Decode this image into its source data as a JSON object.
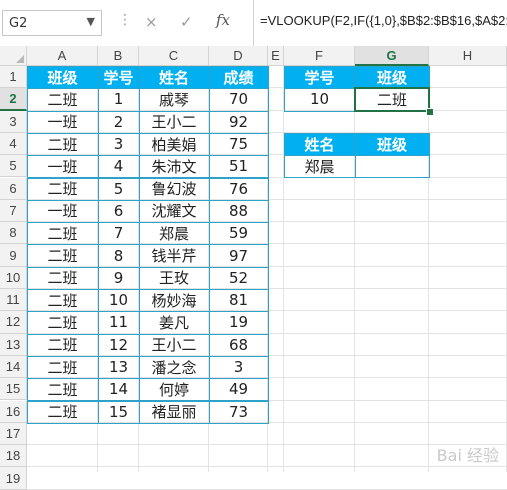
{
  "name_box": {
    "value": "G2"
  },
  "formula_bar": {
    "cancel_icon": "×",
    "enter_icon": "✓",
    "fx_label": "fx",
    "formula": "=VLOOKUP(F2,IF({1,0},$B$2:$B$16,$A$2:$"
  },
  "columns": [
    "A",
    "B",
    "C",
    "D",
    "E",
    "F",
    "G",
    "H"
  ],
  "rows": [
    "1",
    "2",
    "3",
    "4",
    "5",
    "6",
    "7",
    "8",
    "9",
    "10",
    "11",
    "12",
    "13",
    "14",
    "15",
    "16",
    "17",
    "18",
    "19"
  ],
  "table": {
    "headers": [
      "班级",
      "学号",
      "姓名",
      "成绩"
    ],
    "rows": [
      [
        "二班",
        "1",
        "戚琴",
        "70"
      ],
      [
        "一班",
        "2",
        "王小二",
        "92"
      ],
      [
        "二班",
        "3",
        "柏美娟",
        "75"
      ],
      [
        "一班",
        "4",
        "朱沛文",
        "51"
      ],
      [
        "二班",
        "5",
        "鲁幻波",
        "76"
      ],
      [
        "一班",
        "6",
        "沈耀文",
        "88"
      ],
      [
        "二班",
        "7",
        "郑晨",
        "59"
      ],
      [
        "二班",
        "8",
        "钱半芹",
        "97"
      ],
      [
        "二班",
        "9",
        "王玫",
        "52"
      ],
      [
        "二班",
        "10",
        "杨妙海",
        "81"
      ],
      [
        "二班",
        "11",
        "姜凡",
        "19"
      ],
      [
        "二班",
        "12",
        "王小二",
        "68"
      ],
      [
        "二班",
        "13",
        "潘之念",
        "3"
      ],
      [
        "二班",
        "14",
        "何婷",
        "49"
      ],
      [
        "二班",
        "15",
        "褚显丽",
        "73"
      ]
    ]
  },
  "lookup1": {
    "headers": [
      "学号",
      "班级"
    ],
    "values": [
      "10",
      "二班"
    ]
  },
  "lookup2": {
    "headers": [
      "姓名",
      "班级"
    ],
    "values": [
      "郑晨",
      ""
    ]
  },
  "colors": {
    "header_fill": "#00b0f0",
    "table_border": "#2ea3c9",
    "selection": "#217346"
  },
  "watermark": "Bai 经验"
}
